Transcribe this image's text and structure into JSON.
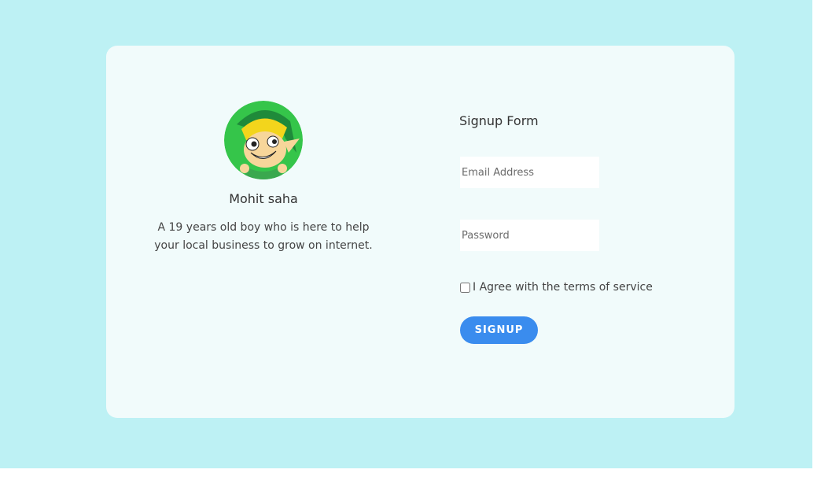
{
  "profile": {
    "name": "Mohit saha",
    "bio": "A 19 years old boy who is here to help your local business to grow on internet.",
    "avatar_icon": "cartoon-avatar"
  },
  "form": {
    "title": "Signup Form",
    "email_placeholder": "Email Address",
    "email_value": "",
    "password_placeholder": "Password",
    "password_value": "",
    "terms_label": "I Agree with the terms of service",
    "terms_checked": false,
    "submit_label": "SIGNUP"
  },
  "colors": {
    "background": "#bdf1f4",
    "card": "#f1fbfb",
    "button": "#3a8cee",
    "avatar_bg": "#35c54a"
  }
}
